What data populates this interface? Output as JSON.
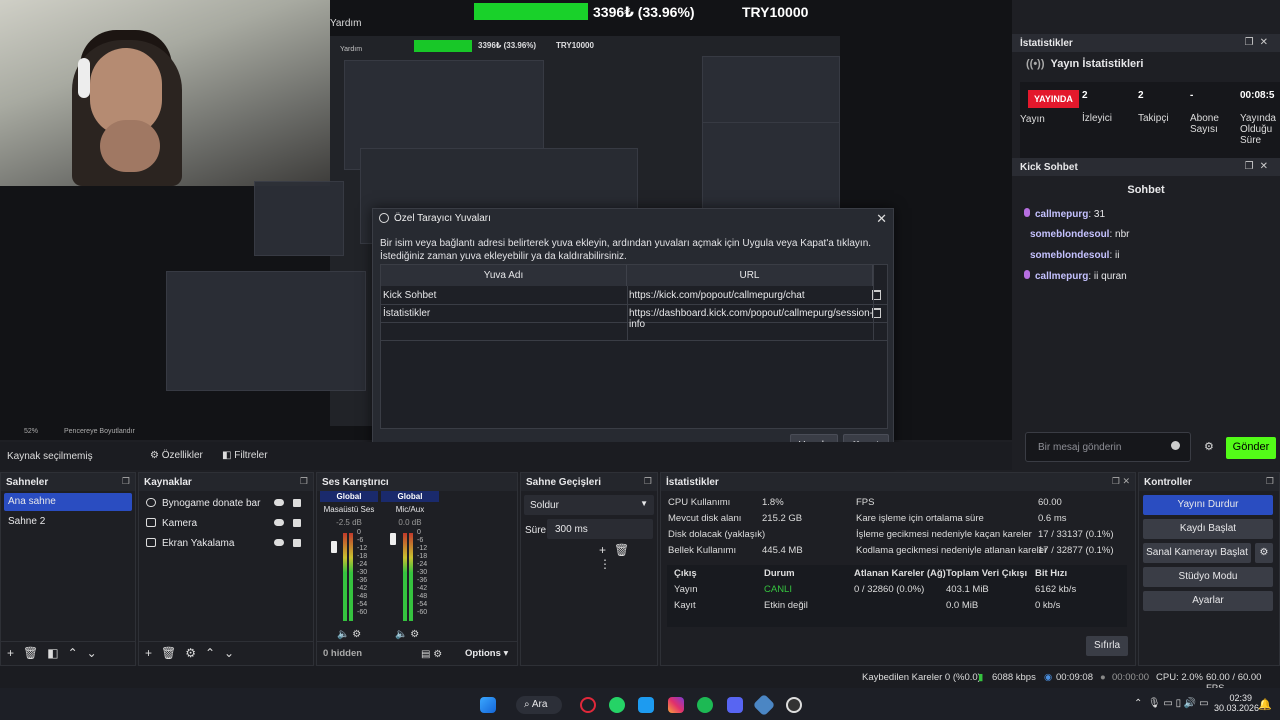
{
  "overlay": {
    "progress_text": "3396₺ (33.96%)",
    "progress_value": 0.3396,
    "target": "TRY10000",
    "menu_yardim": "Yardım"
  },
  "nested_preview": {
    "progress_text": "3396₺ (33.96%)",
    "target": "TRY10000",
    "menu_yardim": "Yardım",
    "zoom": "52%",
    "resize_label": "Pencereye Boyutlandır"
  },
  "stats_dock": {
    "title": "İstatistikler",
    "heading": "Yayın İstatistikleri",
    "badge": "YAYINDA",
    "badge_caption": "Yayın",
    "viewers_value": "2",
    "viewers_label": "İzleyici",
    "followers_value": "2",
    "followers_label": "Takipçi",
    "subs_value": "-",
    "subs_label": "Abone Sayısı",
    "duration_value": "00:08:5",
    "duration_label": "Yayında Olduğu Süre"
  },
  "chat_dock": {
    "title": "Kick Sohbet",
    "heading": "Sohbet",
    "messages": [
      {
        "user": "callmepurg",
        "text": "31",
        "mic": true
      },
      {
        "user": "someblondesoul",
        "text": "nbr",
        "mic": false
      },
      {
        "user": "someblondesoul",
        "text": "ii",
        "mic": false
      },
      {
        "user": "callmepurg",
        "text": "ii quran",
        "mic": true
      }
    ],
    "input_placeholder": "Bir mesaj gönderin",
    "send_label": "Gönder"
  },
  "dialog": {
    "title": "Özel Tarayıcı Yuvaları",
    "description": "Bir isim veya bağlantı adresi belirterek yuva ekleyin, ardından yuvaları açmak için Uygula veya Kapat'a tıklayın. İstediğiniz zaman yuva ekleyebilir ya da kaldırabilirsiniz.",
    "col_name": "Yuva Adı",
    "col_url": "URL",
    "rows": [
      {
        "name": "Kick Sohbet",
        "url": "https://kick.com/popout/callmepurg/chat"
      },
      {
        "name": "İstatistikler",
        "url": "https://dashboard.kick.com/popout/callmepurg/session-info"
      }
    ],
    "apply_label": "Uygula",
    "close_label": "Kapat"
  },
  "source_toolbar": {
    "no_source": "Kaynak seçilmemiş",
    "properties": "Özellikler",
    "filters": "Filtreler"
  },
  "scenes": {
    "title": "Sahneler",
    "items": [
      "Ana sahne",
      "Sahne 2"
    ],
    "selected": 0
  },
  "sources": {
    "title": "Kaynaklar",
    "items": [
      "Bynogame donate bar",
      "Kamera",
      "Ekran Yakalama"
    ]
  },
  "mixer": {
    "title": "Ses Karıştırıcı",
    "channels": [
      {
        "global": "Global",
        "name": "Masaüstü Ses",
        "db": "-2.5 dB"
      },
      {
        "global": "Global",
        "name": "Mic/Aux",
        "db": "0.0 dB"
      }
    ],
    "ticks": [
      "0",
      "-6",
      "-12",
      "-18",
      "-24",
      "-30",
      "-36",
      "-42",
      "-48",
      "-54",
      "-60"
    ],
    "hidden": "0 hidden",
    "options": "Options"
  },
  "transitions": {
    "title": "Sahne Geçişleri",
    "transition": "Soldur",
    "duration_label": "Süre",
    "duration_value": "300 ms"
  },
  "obs_stats": {
    "title": "İstatistikler",
    "rows_left": [
      {
        "label": "CPU Kullanımı",
        "value": "1.8%"
      },
      {
        "label": "Mevcut disk alanı",
        "value": "215.2 GB"
      },
      {
        "label": "Disk dolacak (yaklaşık)",
        "value": "17 / 33137 (0.1%)"
      },
      {
        "label": "Bellek Kullanımı",
        "value": "445.4 MB"
      }
    ],
    "rows_right": [
      {
        "label": "FPS",
        "value": "60.00"
      },
      {
        "label": "Kare işleme için ortalama süre",
        "value": "0.6 ms"
      },
      {
        "label": "İşleme gecikmesi nedeniyle kaçan kareler",
        "value": "17 / 33137 (0.1%)"
      },
      {
        "label": "Kodlama gecikmesi nedeniyle atlanan kareler",
        "value": "17 / 32877 (0.1%)"
      }
    ],
    "out_headers": [
      "Çıkış",
      "Durum",
      "Atlanan Kareler (Ağ)",
      "Toplam Veri Çıkışı",
      "Bit Hızı"
    ],
    "out_rows": [
      [
        "Yayın",
        "CANLI",
        "0 / 32860 (0.0%)",
        "403.1 MiB",
        "6162 kb/s"
      ],
      [
        "Kayıt",
        "Etkin değil",
        "",
        "0.0 MiB",
        "0 kb/s"
      ]
    ],
    "reset": "Sıfırla",
    "live_color": "#35c33f"
  },
  "controls": {
    "title": "Kontroller",
    "stop_stream": "Yayını Durdur",
    "start_record": "Kaydı Başlat",
    "virtual_cam": "Sanal Kamerayı Başlat",
    "studio": "Stüdyo Modu",
    "settings": "Ayarlar",
    "accent": "#2a4dc1"
  },
  "statusbar": {
    "dropped": "Kaybedilen Kareler 0 (%0.0)",
    "bitrate": "6088 kbps",
    "stream_time": "00:09:08",
    "record_time": "00:00:00",
    "cpu": "CPU: 2.0%",
    "fps": "60.00 / 60.00 FPS"
  },
  "taskbar": {
    "search": "Ara",
    "time": "02:39",
    "date": "30.03.2026"
  }
}
